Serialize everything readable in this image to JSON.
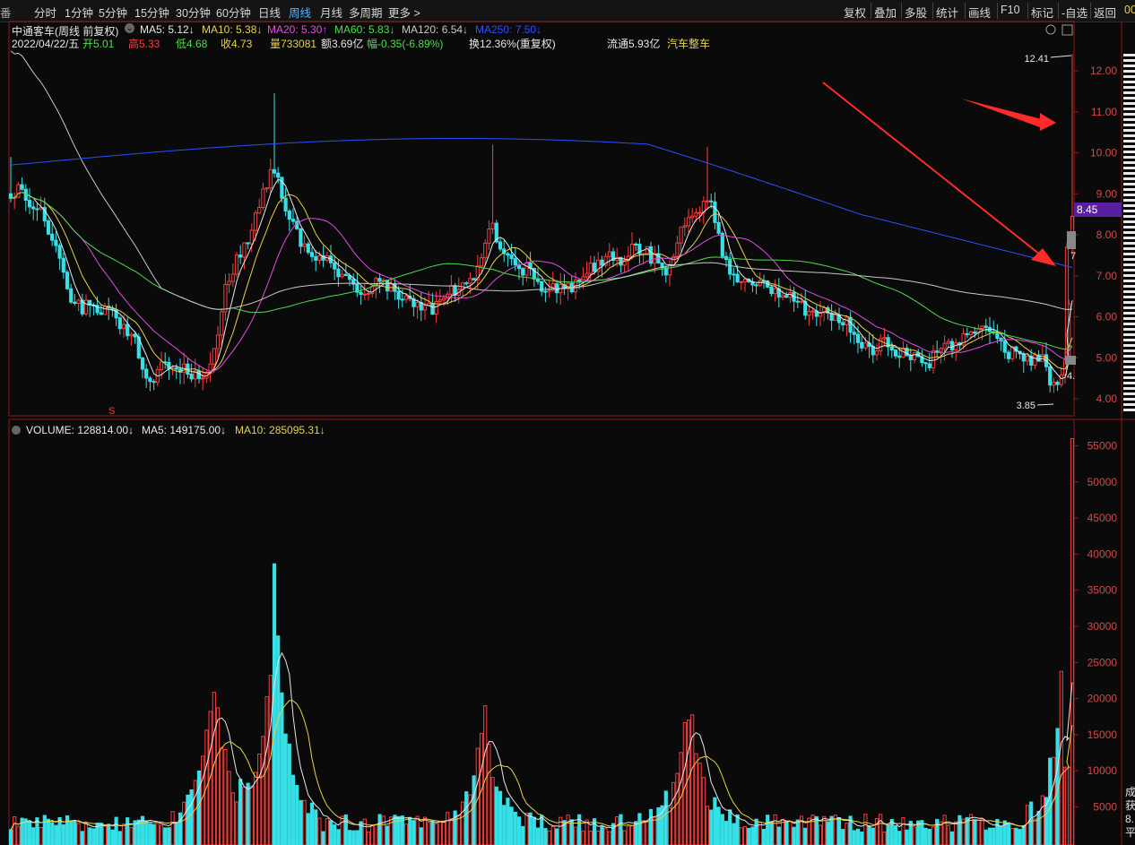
{
  "toolbar": {
    "left_edge": "番",
    "periods": [
      "分时",
      "1分钟",
      "5分钟",
      "15分钟",
      "30分钟",
      "60分钟",
      "日线",
      "周线",
      "月线",
      "多周期",
      "更多 >"
    ],
    "active_period": "周线",
    "right": [
      "复权",
      "叠加",
      "多股",
      "统计",
      "画线",
      "F10",
      "标记",
      "-自选",
      "返回"
    ],
    "far_right": "00"
  },
  "header": {
    "stock": "中通客车(周线 前复权)",
    "ma": [
      {
        "label": "MA5: 5.12",
        "arrow": "↓",
        "color": "#e8e8e8"
      },
      {
        "label": "MA10: 5.38",
        "arrow": "↓",
        "color": "#e6d24a"
      },
      {
        "label": "MA20: 5.30",
        "arrow": "↑",
        "color": "#e04de0"
      },
      {
        "label": "MA60: 5.83",
        "arrow": "↓",
        "color": "#4ddc4d"
      },
      {
        "label": "MA120: 6.54",
        "arrow": "↓",
        "color": "#c8c8c8"
      },
      {
        "label": "MA250: 7.50",
        "arrow": "↓",
        "color": "#2b50ff"
      }
    ],
    "info": {
      "date": "2022/04/22/五",
      "open": "开5.01",
      "high": "高5.33",
      "low": "低4.68",
      "close": "收4.73",
      "vol": "量733081",
      "amount": "额3.69亿",
      "change": "幅-0.35(-6.89%)",
      "turnover": "换12.36%(重复权)",
      "float": "流通5.93亿",
      "sector": "汽车整车"
    }
  },
  "colors": {
    "up": "#ff3b3b",
    "down": "#35e0e6",
    "ma5": "#e8e8e8",
    "ma10": "#e6d24a",
    "ma20": "#e04de0",
    "ma60": "#4ddc4d",
    "ma120": "#c8c8c8",
    "ma250": "#2b50ff",
    "arrow": "#ff2a2a"
  },
  "annotations": {
    "high_mark": "12.41",
    "low_mark": "3.85",
    "price_tag": "8.45",
    "label_7": "7",
    "label_4": "4.",
    "event_marker": "S"
  },
  "volume_header": [
    {
      "label": "VOLUME: 128814.00",
      "arrow": "↓",
      "color": "#e8e8e8"
    },
    {
      "label": "MA5: 149175.00",
      "arrow": "↓",
      "color": "#e8e8e8"
    },
    {
      "label": "MA10: 285095.31",
      "arrow": "↓",
      "color": "#e6d24a"
    }
  ],
  "side_labels": [
    "成",
    "获",
    "8.",
    "平"
  ],
  "chart_data": [
    {
      "type": "candlestick",
      "title": "中通客车(周线 前复权)",
      "yaxis_ticks": [
        4.0,
        5.0,
        6.0,
        7.0,
        8.0,
        9.0,
        10.0,
        11.0,
        12.0
      ],
      "ylim": [
        3.55,
        12.9
      ],
      "series_points": [
        [
          12,
          9.0
        ],
        [
          22,
          9.1
        ],
        [
          32,
          8.7
        ],
        [
          44,
          8.8
        ],
        [
          56,
          7.9
        ],
        [
          66,
          7.4
        ],
        [
          78,
          6.4
        ],
        [
          90,
          6.2
        ],
        [
          102,
          6.3
        ],
        [
          114,
          6.15
        ],
        [
          126,
          6.0
        ],
        [
          138,
          5.7
        ],
        [
          150,
          5.5
        ],
        [
          160,
          4.7
        ],
        [
          170,
          4.4
        ],
        [
          182,
          4.8
        ],
        [
          194,
          4.85
        ],
        [
          206,
          4.7
        ],
        [
          218,
          4.55
        ],
        [
          230,
          4.6
        ],
        [
          240,
          5.3
        ],
        [
          250,
          6.6
        ],
        [
          260,
          7.2
        ],
        [
          270,
          7.6
        ],
        [
          280,
          8.0
        ],
        [
          290,
          8.8
        ],
        [
          300,
          9.4
        ],
        [
          306,
          9.6
        ],
        [
          314,
          8.9
        ],
        [
          324,
          8.4
        ],
        [
          334,
          7.9
        ],
        [
          344,
          7.6
        ],
        [
          354,
          7.5
        ],
        [
          366,
          7.3
        ],
        [
          378,
          7.0
        ],
        [
          390,
          6.9
        ],
        [
          402,
          6.6
        ],
        [
          414,
          6.7
        ],
        [
          424,
          6.9
        ],
        [
          436,
          6.7
        ],
        [
          448,
          6.5
        ],
        [
          460,
          6.35
        ],
        [
          472,
          6.3
        ],
        [
          484,
          6.2
        ],
        [
          496,
          6.5
        ],
        [
          508,
          6.7
        ],
        [
          520,
          6.9
        ],
        [
          532,
          7.0
        ],
        [
          542,
          7.8
        ],
        [
          550,
          8.2
        ],
        [
          558,
          7.6
        ],
        [
          568,
          7.3
        ],
        [
          578,
          7.1
        ],
        [
          590,
          7.2
        ],
        [
          600,
          6.8
        ],
        [
          612,
          6.6
        ],
        [
          624,
          6.8
        ],
        [
          636,
          6.7
        ],
        [
          648,
          6.9
        ],
        [
          660,
          7.2
        ],
        [
          672,
          7.3
        ],
        [
          684,
          7.5
        ],
        [
          696,
          7.4
        ],
        [
          708,
          7.7
        ],
        [
          718,
          7.6
        ],
        [
          730,
          7.4
        ],
        [
          742,
          7.1
        ],
        [
          752,
          7.5
        ],
        [
          762,
          8.2
        ],
        [
          772,
          8.5
        ],
        [
          782,
          8.6
        ],
        [
          790,
          8.9
        ],
        [
          798,
          8.4
        ],
        [
          806,
          7.6
        ],
        [
          816,
          7.0
        ],
        [
          826,
          6.8
        ],
        [
          836,
          6.9
        ],
        [
          848,
          6.8
        ],
        [
          860,
          6.7
        ],
        [
          872,
          6.6
        ],
        [
          884,
          6.4
        ],
        [
          896,
          6.2
        ],
        [
          908,
          6.15
        ],
        [
          920,
          6.1
        ],
        [
          932,
          6.0
        ],
        [
          944,
          5.9
        ],
        [
          956,
          5.5
        ],
        [
          966,
          5.2
        ],
        [
          976,
          5.25
        ],
        [
          988,
          5.4
        ],
        [
          1000,
          5.2
        ],
        [
          1012,
          5.1
        ],
        [
          1024,
          5.0
        ],
        [
          1036,
          4.9
        ],
        [
          1048,
          5.2
        ],
        [
          1060,
          5.3
        ],
        [
          1072,
          5.4
        ],
        [
          1084,
          5.6
        ],
        [
          1096,
          5.7
        ],
        [
          1106,
          5.5
        ],
        [
          1118,
          5.2
        ],
        [
          1130,
          5.1
        ],
        [
          1142,
          5.0
        ],
        [
          1154,
          4.9
        ],
        [
          1164,
          4.95
        ],
        [
          1174,
          4.3
        ],
        [
          1182,
          4.25
        ],
        [
          1188,
          4.8
        ],
        [
          1193,
          6.4
        ],
        [
          1197,
          8.5
        ]
      ]
    },
    {
      "type": "bar",
      "title": "VOLUME",
      "yaxis_ticks": [
        5000,
        10000,
        15000,
        20000,
        25000,
        30000,
        35000,
        40000,
        45000,
        50000,
        55000
      ],
      "ylim": [
        0,
        57000
      ],
      "peaks": [
        [
          "x",
          238,
          26500
        ],
        [
          "x",
          305,
          38000
        ],
        [
          "x",
          540,
          21500
        ],
        [
          "x",
          768,
          25000
        ],
        [
          "x",
          1197,
          56000
        ]
      ]
    }
  ]
}
